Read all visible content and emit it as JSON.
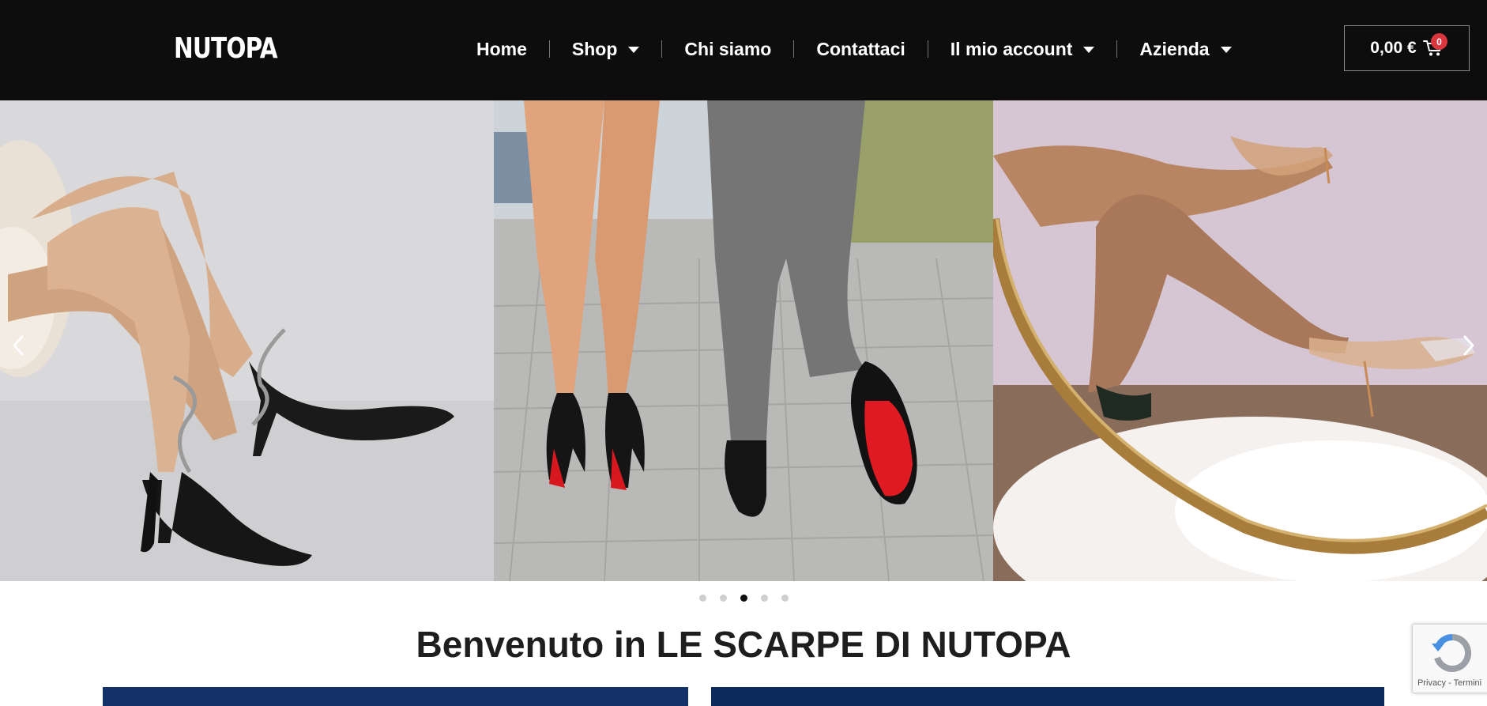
{
  "header": {
    "logo": "NUTOPA",
    "nav": [
      {
        "label": "Home",
        "has_dropdown": false
      },
      {
        "label": "Shop",
        "has_dropdown": true
      },
      {
        "label": "Chi siamo",
        "has_dropdown": false
      },
      {
        "label": "Contattaci",
        "has_dropdown": false
      },
      {
        "label": "Il mio account",
        "has_dropdown": true
      },
      {
        "label": "Azienda",
        "has_dropdown": true
      }
    ],
    "cart": {
      "total": "0,00 €",
      "count": "0",
      "icon": "cart-icon"
    }
  },
  "slider": {
    "slides": [
      {
        "name": "slide-black-heels"
      },
      {
        "name": "slide-red-soles-couple"
      },
      {
        "name": "slide-clear-heels"
      }
    ],
    "prev_icon": "chevron-left-icon",
    "next_icon": "chevron-right-icon",
    "dots_total": 5,
    "active_dot": 3
  },
  "main": {
    "welcome_title": "Benvenuto in LE SCARPE DI NUTOPA"
  },
  "recaptcha": {
    "footer_text": "Privacy - Termini"
  },
  "colors": {
    "header_bg": "#0d0d0d",
    "badge": "#d9363e",
    "panel_left": "#14326a",
    "panel_right": "#0c2b5c"
  }
}
